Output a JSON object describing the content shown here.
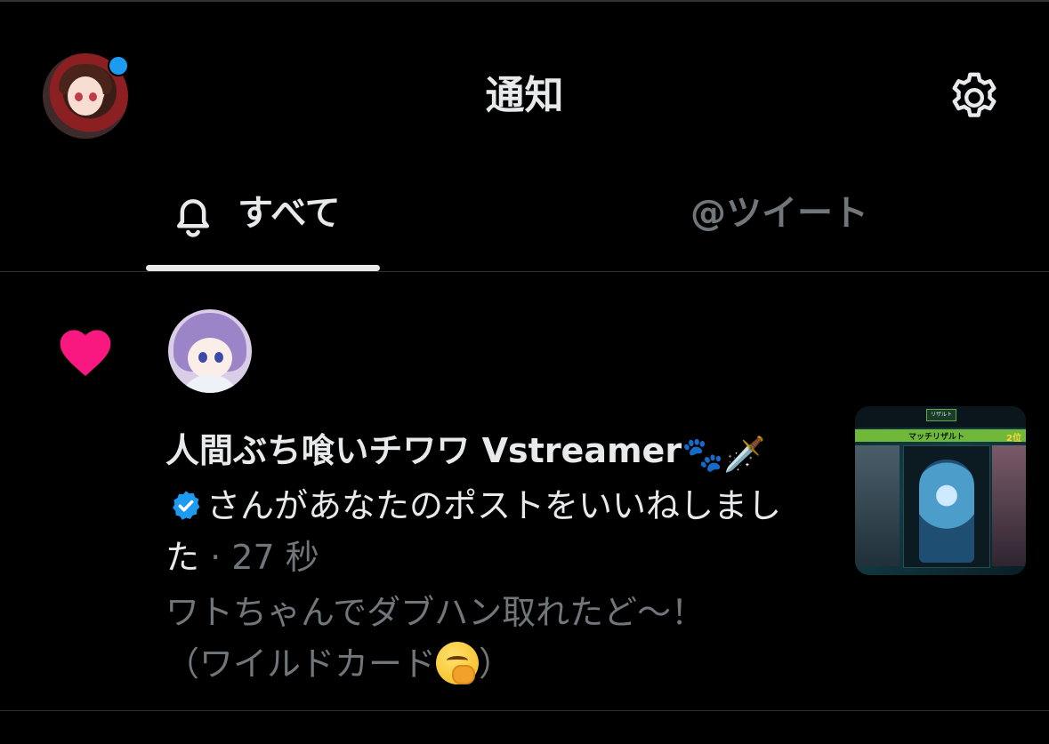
{
  "header": {
    "title": "通知"
  },
  "tabs": [
    {
      "label": "すべて",
      "active": true
    },
    {
      "label": "@ツイート",
      "active": false
    }
  ],
  "notification": {
    "type_icon": "heart-icon",
    "user_name": "人間ぶち喰いチワワ Vstreamer",
    "name_emoji": "🐾🗡️",
    "verified": true,
    "action_text": "さんがあなたのポストをいいねしました",
    "separator": "·",
    "time": "27 秒",
    "preview_line1": "ワトちゃんでダブハン取れたど〜！",
    "preview_line2_prefix": "（ワイルドカード",
    "preview_line2_suffix": "）",
    "thumbnail": {
      "tab_label": "リザルト",
      "banner_text": "マッチリザルト",
      "rank_text": "2位"
    }
  },
  "colors": {
    "background": "#000000",
    "primary_text": "#e7e9ea",
    "secondary_text": "#71767b",
    "like": "#f91880",
    "verified": "#1d9bf0",
    "notification_dot": "#1d9bf0",
    "divider": "#2f3336"
  }
}
